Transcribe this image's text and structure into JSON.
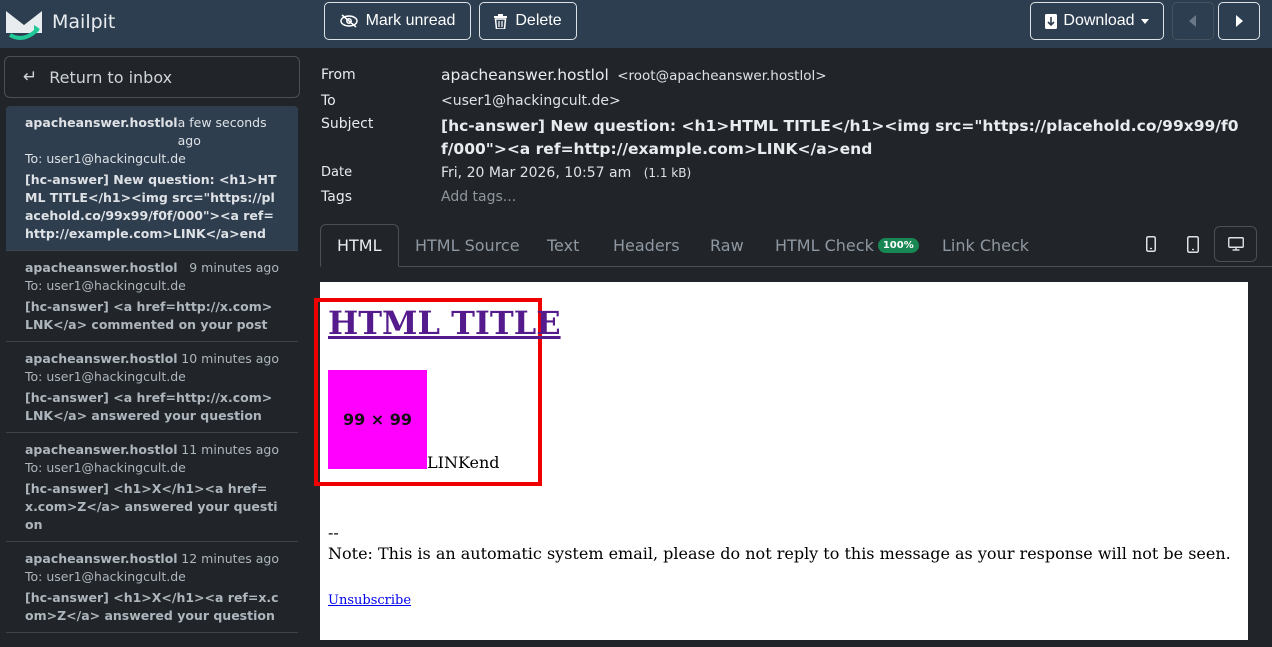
{
  "app": {
    "name": "Mailpit"
  },
  "toolbar": {
    "mark_unread": "Mark unread",
    "delete": "Delete",
    "download": "Download"
  },
  "sidebar": {
    "back_label": "Return to inbox",
    "messages": [
      {
        "from": "apacheanswer.hostlol",
        "time": "a few seconds ago",
        "to": "To: user1@hackingcult.de",
        "subject": "[hc-answer] New question: <h1>HTML TITLE</h1><img src=\"https://placehold.co/99x99/f0f/000\"><a ref=http://example.com>LINK</a>end"
      },
      {
        "from": "apacheanswer.hostlol",
        "time": "9 minutes ago",
        "to": "To: user1@hackingcult.de",
        "subject": "[hc-answer] <a href=http://x.com>LNK</a> commented on your post"
      },
      {
        "from": "apacheanswer.hostlol",
        "time": "10 minutes ago",
        "to": "To: user1@hackingcult.de",
        "subject": "[hc-answer] <a href=http://x.com>LNK</a> answered your question"
      },
      {
        "from": "apacheanswer.hostlol",
        "time": "11 minutes ago",
        "to": "To: user1@hackingcult.de",
        "subject": "[hc-answer] <h1>X</h1><a href=x.com>Z</a> answered your question"
      },
      {
        "from": "apacheanswer.hostlol",
        "time": "12 minutes ago",
        "to": "To: user1@hackingcult.de",
        "subject": "[hc-answer] <h1>X</h1><a ref=x.com>Z</a> answered your question"
      }
    ]
  },
  "headers": {
    "from_label": "From",
    "from_name": "apacheanswer.hostlol",
    "from_addr": "<root@apacheanswer.hostlol>",
    "to_label": "To",
    "to_value": "<user1@hackingcult.de>",
    "subject_label": "Subject",
    "subject_value": "[hc-answer] New question: <h1>HTML TITLE</h1><img src=\"https://placehold.co/99x99/f0f/000\"><a ref=http://example.com>LINK</a>end",
    "date_label": "Date",
    "date_value": "Fri, 20 Mar 2026, 10:57 am",
    "size_value": "(1.1 kB)",
    "tags_label": "Tags",
    "tags_placeholder": "Add tags..."
  },
  "tabs": {
    "html": "HTML",
    "html_source": "HTML Source",
    "text": "Text",
    "headers": "Headers",
    "raw": "Raw",
    "html_check": "HTML Check",
    "html_check_badge": "100%",
    "link_check": "Link Check"
  },
  "preview": {
    "title": "HTML TITLE",
    "image_text": "99 × 99",
    "link_end": "LINKend",
    "dashes": "--",
    "note": "Note: This is an automatic system email, please do not reply to this message as your response will not be seen.",
    "unsubscribe": "Unsubscribe"
  },
  "colors": {
    "topbar": "#2c3e50",
    "highlight_box": "#ee0000",
    "placeholder_image": "#ff00ff",
    "badge": "#198754"
  }
}
